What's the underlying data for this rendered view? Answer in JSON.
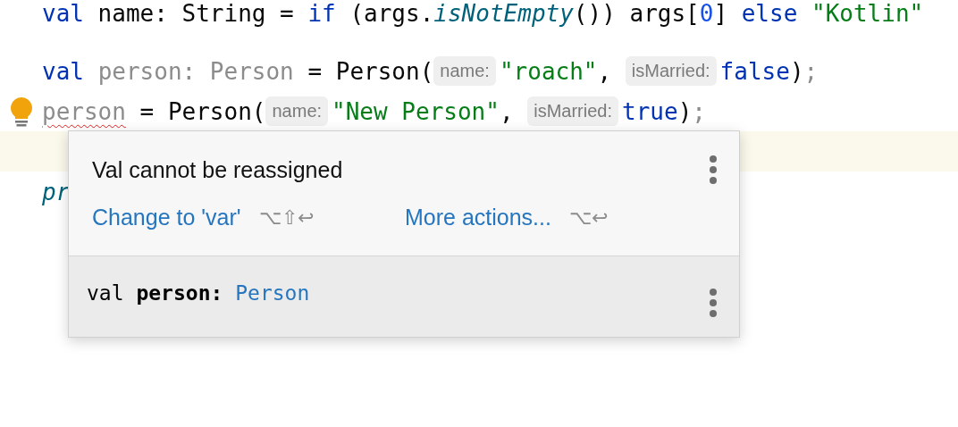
{
  "code_lines": [
    {
      "bulb": false,
      "current": false,
      "tokens": [
        {
          "kind": "keyword",
          "text": "val"
        },
        {
          "kind": "plain",
          "text": " name: String = "
        },
        {
          "kind": "keyword",
          "text": "if"
        },
        {
          "kind": "plain",
          "text": " (args."
        },
        {
          "kind": "call",
          "text": "isNotEmpty"
        },
        {
          "kind": "plain",
          "text": "()) args["
        },
        {
          "kind": "number",
          "text": "0"
        },
        {
          "kind": "plain",
          "text": "] "
        },
        {
          "kind": "keyword",
          "text": "else "
        },
        {
          "kind": "string",
          "text": "\"Kotlin\""
        }
      ]
    },
    {
      "bulb": false,
      "current": false,
      "tokens": [
        {
          "kind": "keyword",
          "text": "val "
        },
        {
          "kind": "muted",
          "text": "person: Person"
        },
        {
          "kind": "plain",
          "text": " = Person("
        },
        {
          "kind": "hint",
          "text": "name:"
        },
        {
          "kind": "string",
          "text": "\"roach\""
        },
        {
          "kind": "plain",
          "text": ", "
        },
        {
          "kind": "hint",
          "text": "isMarried:"
        },
        {
          "kind": "keyword",
          "text": "false"
        },
        {
          "kind": "plain",
          "text": ")"
        },
        {
          "kind": "muted",
          "text": ";"
        }
      ]
    },
    {
      "bulb": true,
      "current": false,
      "tokens": [
        {
          "kind": "error",
          "text": "person"
        },
        {
          "kind": "plain",
          "text": " = Person("
        },
        {
          "kind": "hint",
          "text": "name:"
        },
        {
          "kind": "string",
          "text": "\"New Person\""
        },
        {
          "kind": "plain",
          "text": ", "
        },
        {
          "kind": "hint",
          "text": "isMarried:"
        },
        {
          "kind": "keyword",
          "text": "true"
        },
        {
          "kind": "plain",
          "text": ")"
        },
        {
          "kind": "muted",
          "text": ";"
        }
      ]
    },
    {
      "bulb": false,
      "current": true
    },
    {
      "bulb": false,
      "current": false,
      "tokens": [
        {
          "kind": "call",
          "text": "pr"
        }
      ]
    }
  ],
  "popup": {
    "title": "Val cannot be reassigned",
    "actions": [
      {
        "label": "Change to 'var'",
        "shortcut": "⌥⇧↩"
      },
      {
        "label": "More actions...",
        "shortcut": "⌥↩"
      }
    ],
    "declaration": [
      {
        "kind": "keyword",
        "text": "val"
      },
      {
        "kind": "name",
        "text": "person:"
      },
      {
        "kind": "type",
        "text": "Person"
      }
    ]
  }
}
